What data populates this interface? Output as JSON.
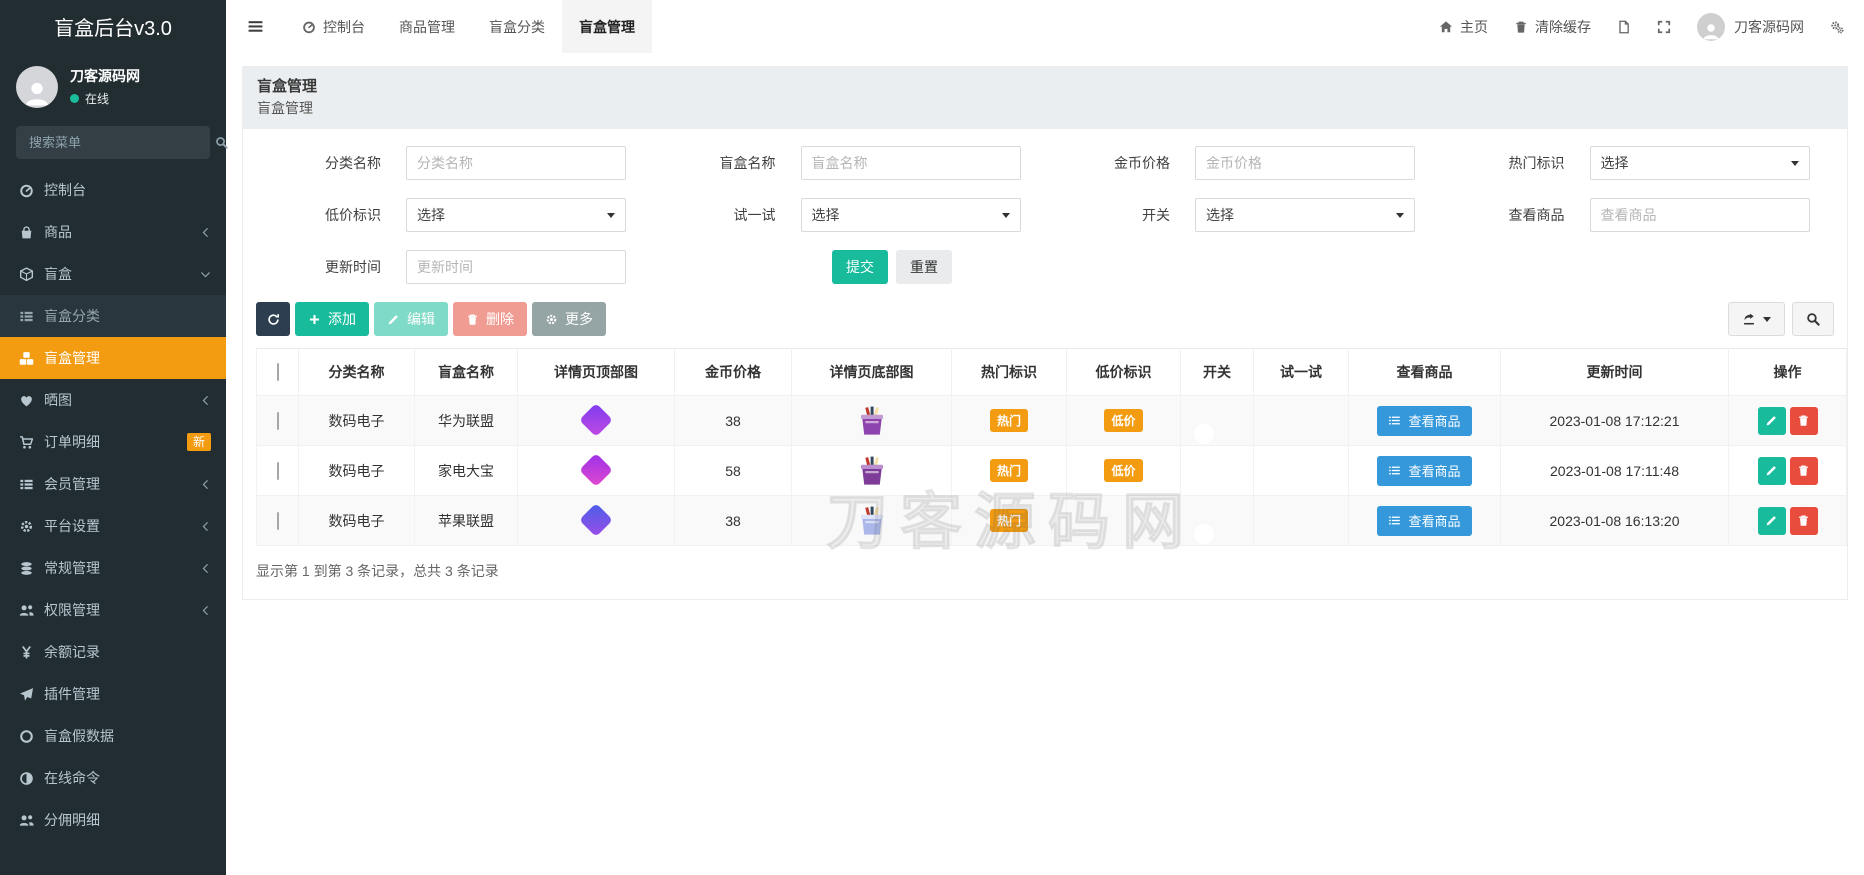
{
  "app": {
    "title": "盲盒后台v3.0"
  },
  "colors": {
    "sidebar_bg": "#222d32",
    "accent_orange": "#f39c12",
    "accent_teal": "#18bc9c",
    "accent_blue": "#3498db",
    "accent_red": "#e74c3c",
    "dark_navy": "#2c3e50",
    "gray": "#95a5a6"
  },
  "sidebar": {
    "user": {
      "name": "刀客源码网",
      "status": "在线"
    },
    "search_placeholder": "搜索菜单",
    "menu": [
      {
        "key": "dashboard",
        "label": "控制台",
        "icon": "gauge"
      },
      {
        "key": "goods",
        "label": "商品",
        "icon": "bag",
        "chevron": "left"
      },
      {
        "key": "box",
        "label": "盲盒",
        "icon": "cube",
        "chevron": "down"
      },
      {
        "key": "box-category",
        "label": "盲盒分类",
        "icon": "thlist",
        "submenu": true
      },
      {
        "key": "box-manage",
        "label": "盲盒管理",
        "icon": "cubes",
        "submenu": true,
        "active": true
      },
      {
        "key": "photos",
        "label": "晒图",
        "icon": "heart",
        "chevron": "left"
      },
      {
        "key": "orders",
        "label": "订单明细",
        "icon": "cart",
        "badge": "新"
      },
      {
        "key": "members",
        "label": "会员管理",
        "icon": "thlist",
        "chevron": "left"
      },
      {
        "key": "platform",
        "label": "平台设置",
        "icon": "gear",
        "chevron": "left"
      },
      {
        "key": "general",
        "label": "常规管理",
        "icon": "database",
        "chevron": "left"
      },
      {
        "key": "permissions",
        "label": "权限管理",
        "icon": "users",
        "chevron": "left"
      },
      {
        "key": "balance",
        "label": "余额记录",
        "icon": "yen"
      },
      {
        "key": "plugins",
        "label": "插件管理",
        "icon": "plane"
      },
      {
        "key": "box-fake-data",
        "label": "盲盒假数据",
        "icon": "circleo"
      },
      {
        "key": "online-command",
        "label": "在线命令",
        "icon": "adjust"
      },
      {
        "key": "commission",
        "label": "分佣明细",
        "icon": "users"
      }
    ]
  },
  "navbar": {
    "tabs": [
      {
        "key": "dashboard",
        "label": "控制台",
        "icon": "gauge"
      },
      {
        "key": "goods-manage",
        "label": "商品管理"
      },
      {
        "key": "box-category",
        "label": "盲盒分类"
      },
      {
        "key": "box-manage",
        "label": "盲盒管理",
        "active": true
      }
    ],
    "right": {
      "home": "主页",
      "clear_cache": "清除缓存",
      "username": "刀客源码网"
    }
  },
  "page": {
    "title": "盲盒管理",
    "subtitle": "盲盒管理"
  },
  "filter": {
    "rows": [
      [
        {
          "key": "category-name",
          "label": "分类名称",
          "type": "input",
          "placeholder": "分类名称",
          "value": ""
        },
        {
          "key": "box-name",
          "label": "盲盒名称",
          "type": "input",
          "placeholder": "盲盒名称",
          "value": ""
        },
        {
          "key": "coin-price",
          "label": "金币价格",
          "type": "input",
          "placeholder": "金币价格",
          "value": ""
        },
        {
          "key": "hot-flag",
          "label": "热门标识",
          "type": "select",
          "value": "选择"
        }
      ],
      [
        {
          "key": "cheap-flag",
          "label": "低价标识",
          "type": "select",
          "value": "选择"
        },
        {
          "key": "try-flag",
          "label": "试一试",
          "type": "select",
          "value": "选择"
        },
        {
          "key": "switch",
          "label": "开关",
          "type": "select",
          "value": "选择"
        },
        {
          "key": "view-goods",
          "label": "查看商品",
          "type": "input",
          "placeholder": "查看商品",
          "value": ""
        }
      ],
      [
        {
          "key": "update-time",
          "label": "更新时间",
          "type": "input",
          "placeholder": "更新时间",
          "value": ""
        },
        {
          "key": "form-buttons",
          "type": "buttons"
        }
      ]
    ],
    "submit_label": "提交",
    "reset_label": "重置"
  },
  "toolbar": {
    "add": "添加",
    "edit": "编辑",
    "delete": "删除",
    "more": "更多"
  },
  "table": {
    "columns": [
      "",
      "分类名称",
      "盲盒名称",
      "详情页顶部图",
      "金币价格",
      "详情页底部图",
      "热门标识",
      "低价标识",
      "开关",
      "试一试",
      "查看商品",
      "更新时间",
      "操作"
    ],
    "rows": [
      {
        "category": "数码电子",
        "name": "华为联盟",
        "top_image": "purple-diamond-box",
        "top_gradient": [
          "#7d3cf0",
          "#c04ae2"
        ],
        "price": "38",
        "bottom_image": "purple-gift-box",
        "box_body": "#8e44ad",
        "box_rim": "#c39bd3",
        "hot": "热门",
        "cheap": "低价",
        "switch_on": true,
        "try": "",
        "view_label": "查看商品",
        "updated": "2023-01-08 17:12:21"
      },
      {
        "category": "数码电子",
        "name": "家电大宝",
        "top_image": "purple-diamond-box",
        "top_gradient": [
          "#9b30e8",
          "#e24ad0"
        ],
        "price": "58",
        "bottom_image": "purple-gift-box",
        "box_body": "#7d3c98",
        "box_rim": "#bb8fce",
        "hot": "热门",
        "cheap": "低价",
        "switch_on": true,
        "try": "",
        "view_label": "查看商品",
        "updated": "2023-01-08 17:11:48"
      },
      {
        "category": "数码电子",
        "name": "苹果联盟",
        "top_image": "blue-diamond-box",
        "top_gradient": [
          "#4a5fe8",
          "#9b4de8"
        ],
        "price": "38",
        "bottom_image": "light-gift-box",
        "box_body": "#aab7e8",
        "box_rim": "#dde3fa",
        "hot": "热门",
        "cheap": "",
        "switch_on": true,
        "try": "",
        "view_label": "查看商品",
        "updated": "2023-01-08 16:13:20"
      }
    ],
    "footer": "显示第 1 到第 3 条记录，总共 3 条记录"
  },
  "watermark": "刀客源码网"
}
